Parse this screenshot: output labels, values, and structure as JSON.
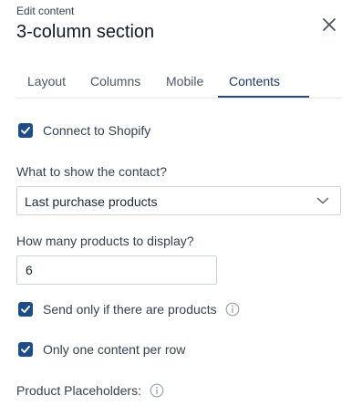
{
  "header": {
    "overline": "Edit content",
    "title": "3-column section",
    "close_icon": "close-icon"
  },
  "tabs": [
    {
      "label": "Layout",
      "active": false
    },
    {
      "label": "Columns",
      "active": false
    },
    {
      "label": "Mobile",
      "active": false
    },
    {
      "label": "Contents",
      "active": true
    }
  ],
  "connect_shopify": {
    "label": "Connect to Shopify",
    "checked": true
  },
  "show_field": {
    "label": "What to show the contact?",
    "selected": "Last purchase products"
  },
  "count_field": {
    "label": "How many products to display?",
    "value": "6"
  },
  "send_only": {
    "label": "Send only if there are products",
    "checked": true,
    "info_icon": "info-icon"
  },
  "one_per_row": {
    "label": "Only one content per row",
    "checked": true
  },
  "placeholders": {
    "label": "Product Placeholders:",
    "info_icon": "info-icon"
  },
  "colors": {
    "accent": "#1f4c86",
    "tab_active": "#1f3a64",
    "border": "#d1d5db"
  }
}
